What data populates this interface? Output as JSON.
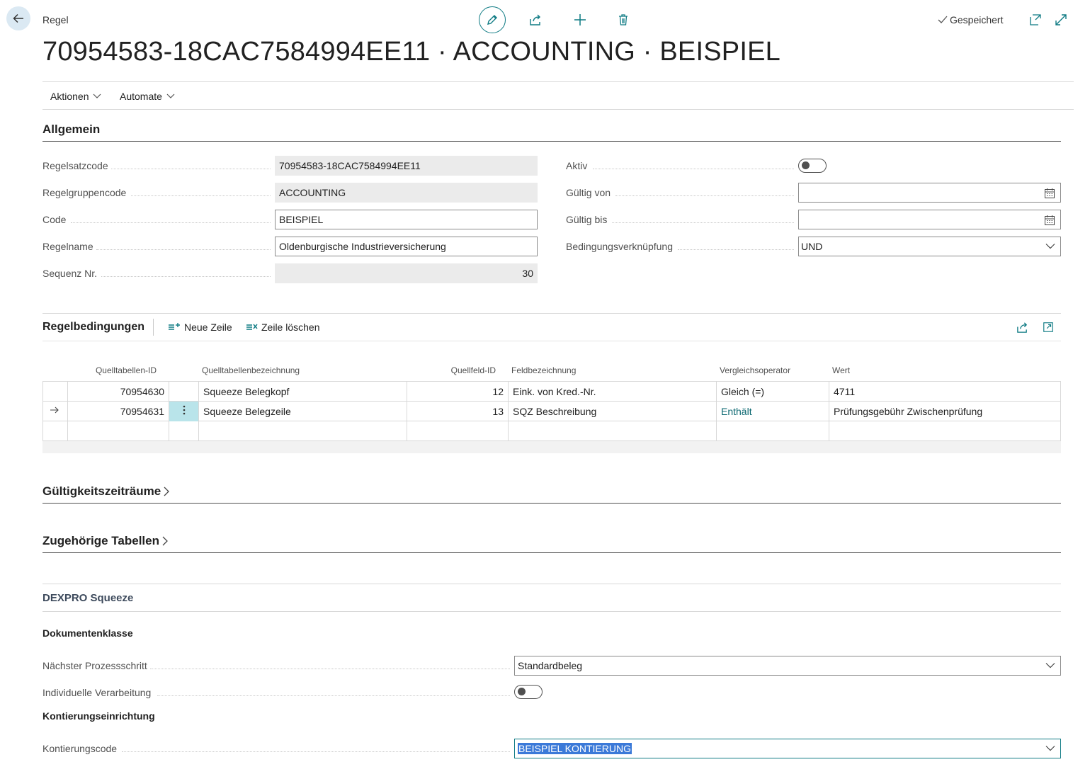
{
  "header": {
    "breadcrumb": "Regel",
    "title": "70954583-18CAC7584994EE11 · ACCOUNTING · BEISPIEL",
    "saved_label": "Gespeichert"
  },
  "actions_bar": {
    "items": [
      {
        "label": "Aktionen"
      },
      {
        "label": "Automate"
      }
    ]
  },
  "general": {
    "title": "Allgemein",
    "left": [
      {
        "label": "Regelsatzcode",
        "value": "70954583-18CAC7584994EE11"
      },
      {
        "label": "Regelgruppencode",
        "value": "ACCOUNTING"
      },
      {
        "label": "Code",
        "value": "BEISPIEL"
      },
      {
        "label": "Regelname",
        "value": "Oldenburgische Industrieversicherung"
      },
      {
        "label": "Sequenz Nr.",
        "value": "30"
      }
    ],
    "right": [
      {
        "label": "Aktiv",
        "toggle_on": false
      },
      {
        "label": "Gültig von",
        "value": ""
      },
      {
        "label": "Gültig bis",
        "value": ""
      },
      {
        "label": "Bedingungsverknüpfung",
        "value": "UND"
      }
    ]
  },
  "conditions": {
    "title": "Regelbedingungen",
    "new_line": "Neue Zeile",
    "delete_line": "Zeile löschen",
    "columns": [
      "Quelltabellen-ID",
      "Quelltabellenbezeichnung",
      "Quellfeld-ID",
      "Feldbezeichnung",
      "Vergleichsoperator",
      "Wert"
    ],
    "rows": [
      {
        "table_id": "70954630",
        "table_name": "Squeeze Belegkopf",
        "field_id": "12",
        "field_name": "Eink. von Kred.-Nr.",
        "operator": "Gleich (=)",
        "value": "4711"
      },
      {
        "table_id": "70954631",
        "table_name": "Squeeze Belegzeile",
        "field_id": "13",
        "field_name": "SQZ Beschreibung",
        "operator": "Enthält",
        "value": "Prüfungsgebühr Zwischenprüfung"
      }
    ]
  },
  "validity": {
    "title": "Gültigkeitszeiträume"
  },
  "related": {
    "title": "Zugehörige Tabellen"
  },
  "dexpro": {
    "title": "DEXPRO Squeeze",
    "doc_class_heading": "Dokumentenklasse",
    "next_step_label": "Nächster Prozessschritt",
    "next_step_value": "Standardbeleg",
    "individual_label": "Individuelle Verarbeitung",
    "individual_on": false,
    "posting_heading": "Kontierungseinrichtung",
    "posting_code_label": "Kontierungscode",
    "posting_code_value": "BEISPIEL KONTIERUNG"
  },
  "colors": {
    "accent": "#0f7b84",
    "selection": "#3b79d8",
    "selected_cell": "#b9e4ea"
  }
}
